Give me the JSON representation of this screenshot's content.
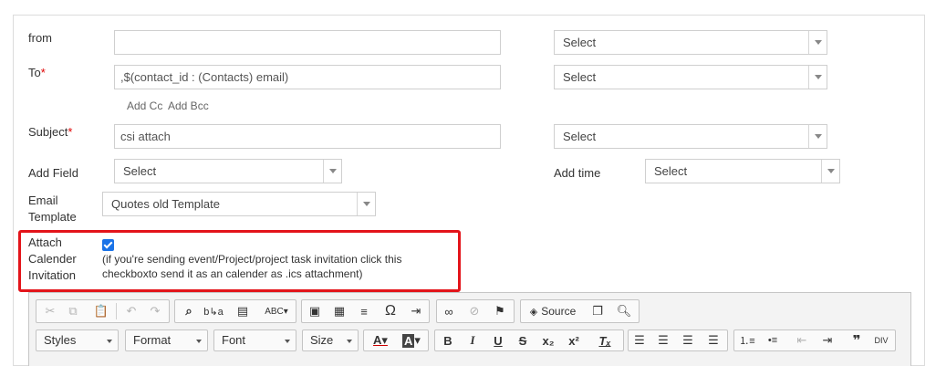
{
  "form": {
    "from_label": "from",
    "from_value": "",
    "from_select": "Select",
    "to_label": "To",
    "required_mark": "*",
    "to_value": ",$(contact_id : (Contacts) email)",
    "to_select": "Select",
    "add_cc": "Add Cc",
    "add_bcc": "Add Bcc",
    "subject_label": "Subject",
    "subject_value": "csi attach",
    "subject_select": "Select",
    "add_field_label": "Add Field",
    "add_field_select": "Select",
    "add_time_label": "Add time",
    "add_time_select": "Select",
    "email_template_label_1": "Email",
    "email_template_label_2": "Template",
    "email_template_select": "Quotes old Template",
    "attach_label_1": "Attach",
    "attach_label_2": "Calender",
    "attach_label_3": "Invitation",
    "attach_checked": true,
    "attach_note_1": "(if you're sending event/Project/project task invitation click this",
    "attach_note_2": "checkboxto send it as an calender as .ics attachment)"
  },
  "toolbar": {
    "source_label": "Source",
    "styles_label": "Styles",
    "format_label": "Format",
    "font_label": "Font",
    "size_label": "Size",
    "icons_row1": [
      "cut-icon",
      "copy-icon",
      "paste-icon",
      "undo-icon",
      "redo-icon",
      "find-icon",
      "replace-icon",
      "paste-text-icon",
      "spellcheck-icon",
      "image-icon",
      "table-icon",
      "hr-icon",
      "special-char-icon",
      "pagebreak-icon",
      "link-icon",
      "unlink-icon",
      "anchor-icon",
      "source-icon",
      "template-icon",
      "preview-icon"
    ],
    "icons_row2": [
      "text-color-icon",
      "bg-color-icon",
      "bold-icon",
      "italic-icon",
      "underline-icon",
      "strike-icon",
      "subscript-icon",
      "superscript-icon",
      "remove-format-icon",
      "align-left-icon",
      "align-center-icon",
      "align-right-icon",
      "justify-icon",
      "numbered-list-icon",
      "bullet-list-icon",
      "outdent-icon",
      "indent-icon",
      "blockquote-icon",
      "div-icon"
    ]
  }
}
